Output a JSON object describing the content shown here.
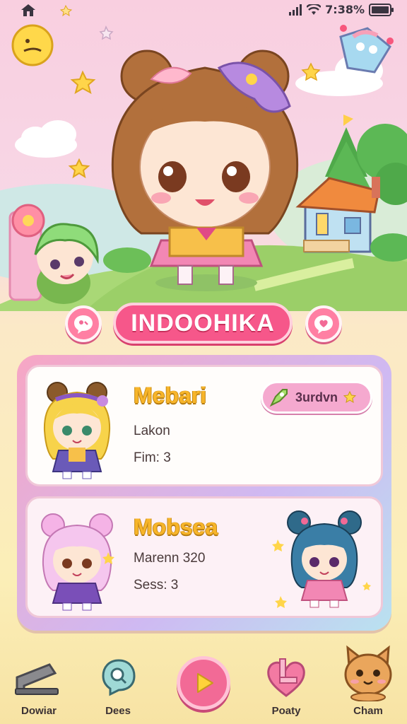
{
  "status_bar": {
    "time": "7:38%"
  },
  "title": "INDOOHIKA",
  "cards": [
    {
      "name": "Mebari",
      "line1": "Lakon",
      "line2": "Fim: 3",
      "action_label": "3urdvn"
    },
    {
      "name": "Mobsea",
      "line1": "Marenn 320",
      "line2": "Sess: 3"
    }
  ],
  "nav": [
    {
      "label": "Dowiar",
      "icon": "cannon-icon"
    },
    {
      "label": "Dees",
      "icon": "search-bubble-icon"
    },
    {
      "label": "",
      "icon": "play-icon"
    },
    {
      "label": "Poaty",
      "icon": "heart-flag-icon"
    },
    {
      "label": "Cham",
      "icon": "cat-icon"
    }
  ],
  "colors": {
    "accent_pink": "#f6578a",
    "title_gold": "#f7b52a",
    "panel_lilac": "#cfb9f2"
  }
}
